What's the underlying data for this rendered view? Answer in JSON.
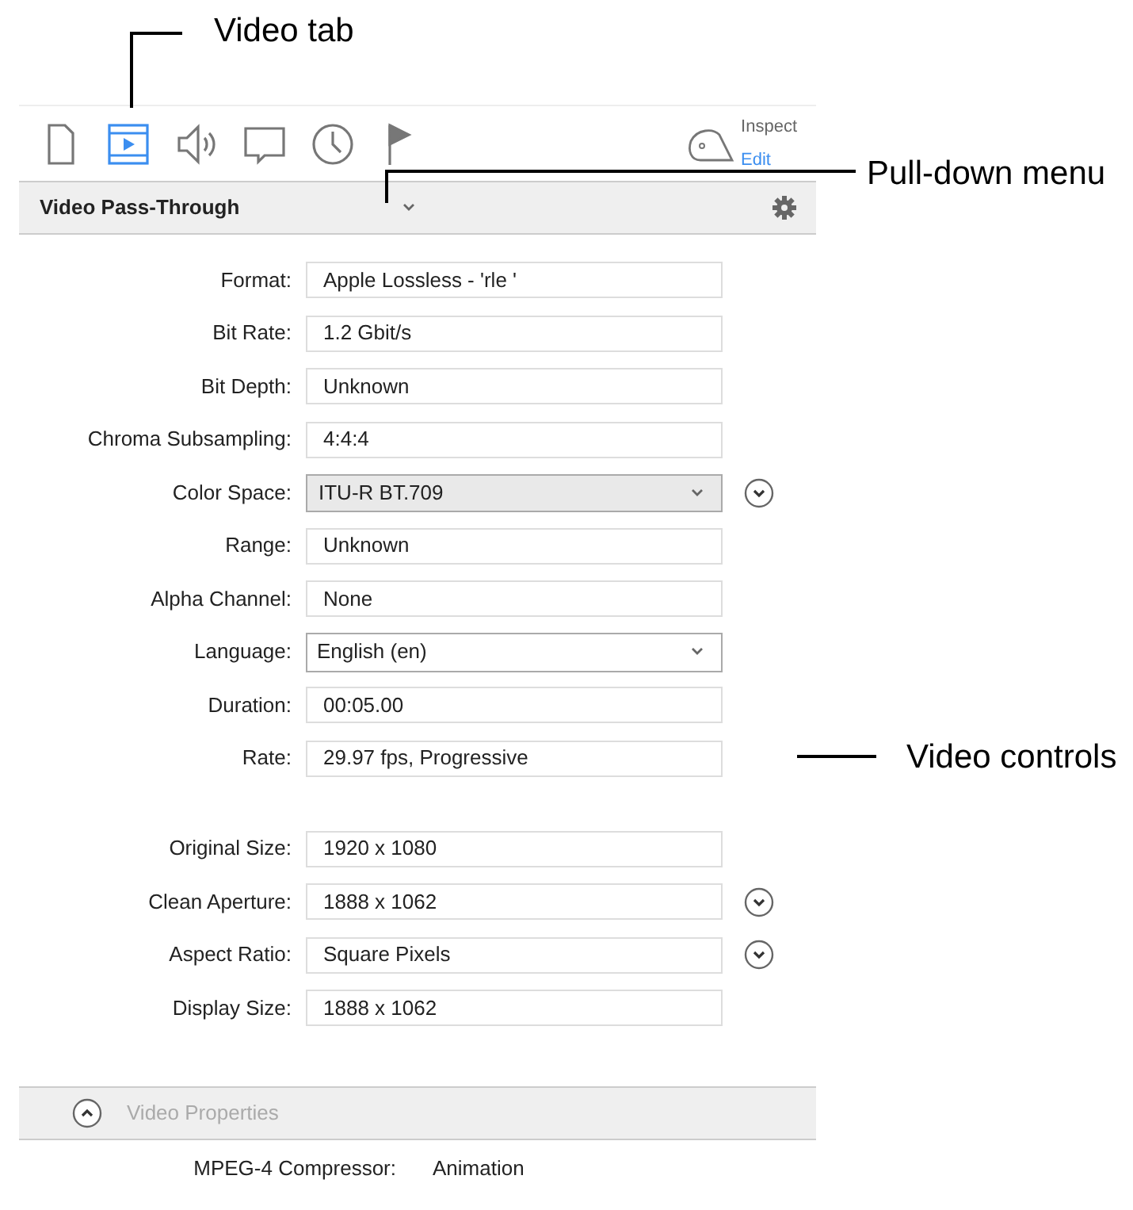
{
  "callouts": [
    {
      "text": "Video tab"
    },
    {
      "text": "Pull-down menu"
    },
    {
      "text": "Video controls"
    }
  ],
  "tabs": [
    {
      "kind": "document",
      "selected": false
    },
    {
      "kind": "video",
      "selected": true
    },
    {
      "kind": "audio",
      "selected": false
    },
    {
      "kind": "caption",
      "selected": false
    },
    {
      "kind": "clock",
      "selected": false
    },
    {
      "kind": "flag",
      "selected": false
    }
  ],
  "inspect_edit": [
    {
      "label": "Inspect",
      "selected": false
    },
    {
      "label": "Edit",
      "selected": true
    }
  ],
  "preset_menu": {
    "value": "Video Pass-Through"
  },
  "field_groups": [
    [
      {
        "label": "Format:",
        "kind": "text",
        "value": "Apple Lossless - 'rle '"
      },
      {
        "label": "Bit Rate:",
        "kind": "text",
        "value": "1.2 Gbit/s"
      },
      {
        "label": "Bit Depth:",
        "kind": "text",
        "value": "Unknown"
      },
      {
        "label": "Chroma Subsampling:",
        "kind": "text",
        "value": "4:4:4"
      },
      {
        "label": "Color Space:",
        "kind": "popup",
        "value": "ITU-R BT.709",
        "expand_button": true
      },
      {
        "label": "Range:",
        "kind": "text",
        "value": "Unknown"
      },
      {
        "label": "Alpha Channel:",
        "kind": "text",
        "value": "None"
      },
      {
        "label": "Language:",
        "kind": "select",
        "value": "English (en)"
      },
      {
        "label": "Duration:",
        "kind": "text",
        "value": "00:05.00"
      },
      {
        "label": "Rate:",
        "kind": "text",
        "value": "29.97 fps, Progressive"
      }
    ],
    [
      {
        "label": "Original Size:",
        "kind": "text",
        "value": "1920 x 1080"
      },
      {
        "label": "Clean Aperture:",
        "kind": "text",
        "value": "1888 x 1062",
        "expand_button": true
      },
      {
        "label": "Aspect Ratio:",
        "kind": "text",
        "value": "Square Pixels",
        "expand_button": true
      },
      {
        "label": "Display Size:",
        "kind": "text",
        "value": "1888 x 1062"
      }
    ]
  ],
  "properties_section": {
    "title": "Video Properties",
    "expanded": true,
    "rows": [
      {
        "label": "MPEG-4 Compressor:",
        "value": "Animation"
      }
    ]
  }
}
